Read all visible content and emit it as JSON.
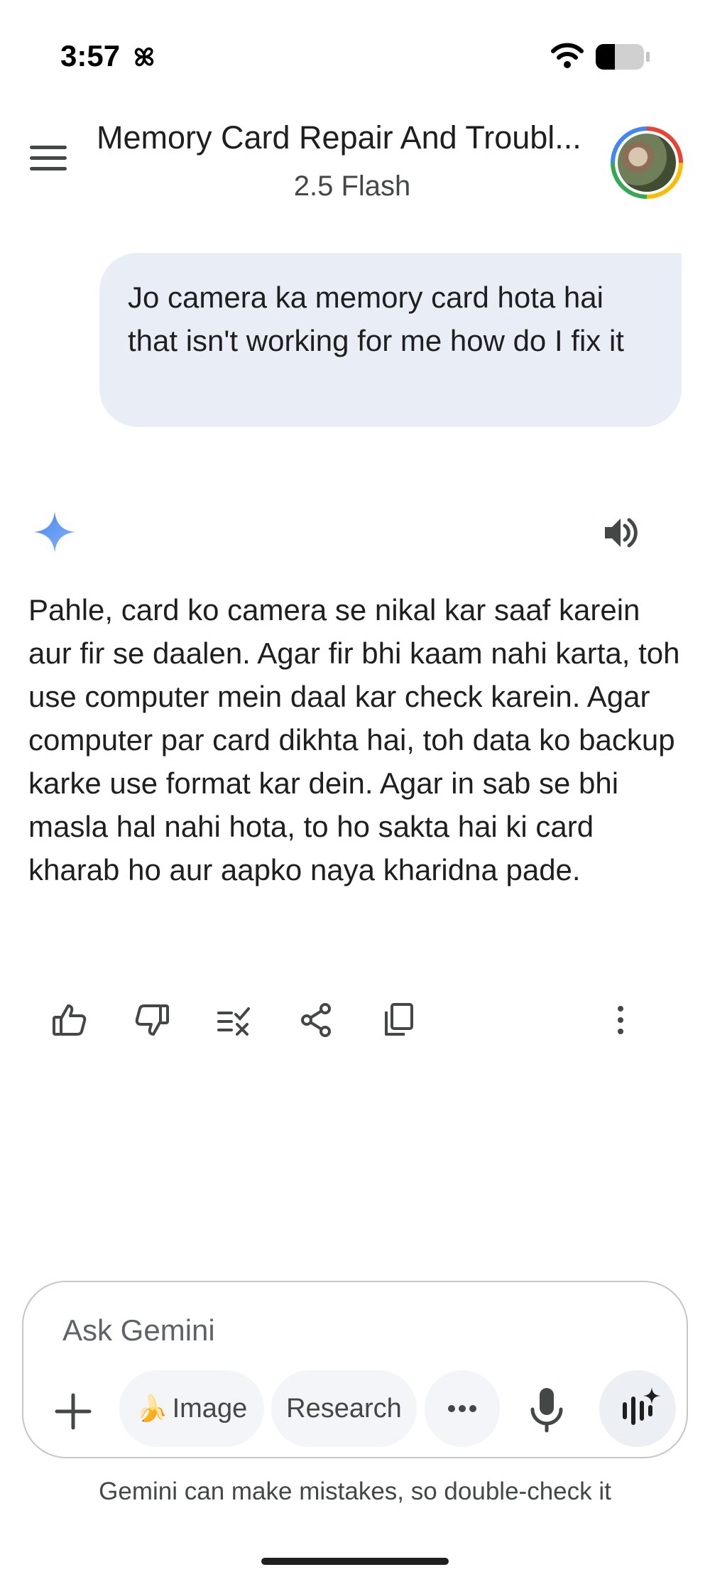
{
  "status_bar": {
    "time": "3:57",
    "activity_icon": "pinwheel-icon",
    "wifi_icon": "wifi-icon",
    "battery_icon": "battery-icon",
    "battery_level": 0.4
  },
  "header": {
    "menu_icon": "hamburger-menu-icon",
    "title": "Memory Card Repair And Troubl...",
    "model": "2.5 Flash",
    "avatar": "profile-avatar"
  },
  "conversation": {
    "user_message": "Jo camera ka memory card hota hai that isn't working for me how do I fix it",
    "assistant_icon": "gemini-spark-icon",
    "read_aloud_icon": "speaker-icon",
    "assistant_response": "Pahle, card ko camera se nikal kar saaf karein aur fir se daalen. Agar fir bhi kaam nahi karta, toh use computer mein daal kar check karein. Agar computer par card dikhta hai, toh data ko backup karke use format kar dein. Agar in sab se bhi masla hal nahi hota, to ho sakta hai ki card kharab ho aur aapko naya kharidna pade.",
    "actions": [
      "thumbs-up-icon",
      "thumbs-down-icon",
      "double-check-icon",
      "share-icon",
      "copy-icon",
      "more-vert-icon"
    ]
  },
  "composer": {
    "placeholder": "Ask Gemini",
    "add_icon": "plus-icon",
    "image_chip": "Image",
    "image_chip_emoji": "🍌",
    "research_chip": "Research",
    "more_icon": "more-horiz-icon",
    "mic_icon": "microphone-icon",
    "live_icon": "gemini-live-icon"
  },
  "disclaimer": "Gemini can make mistakes, so double-check it",
  "colors": {
    "bubble": "#e9eef6",
    "spark_start": "#4285f4",
    "spark_end": "#8ab4f8",
    "text": "#1f1f1f",
    "icon": "#444746"
  }
}
